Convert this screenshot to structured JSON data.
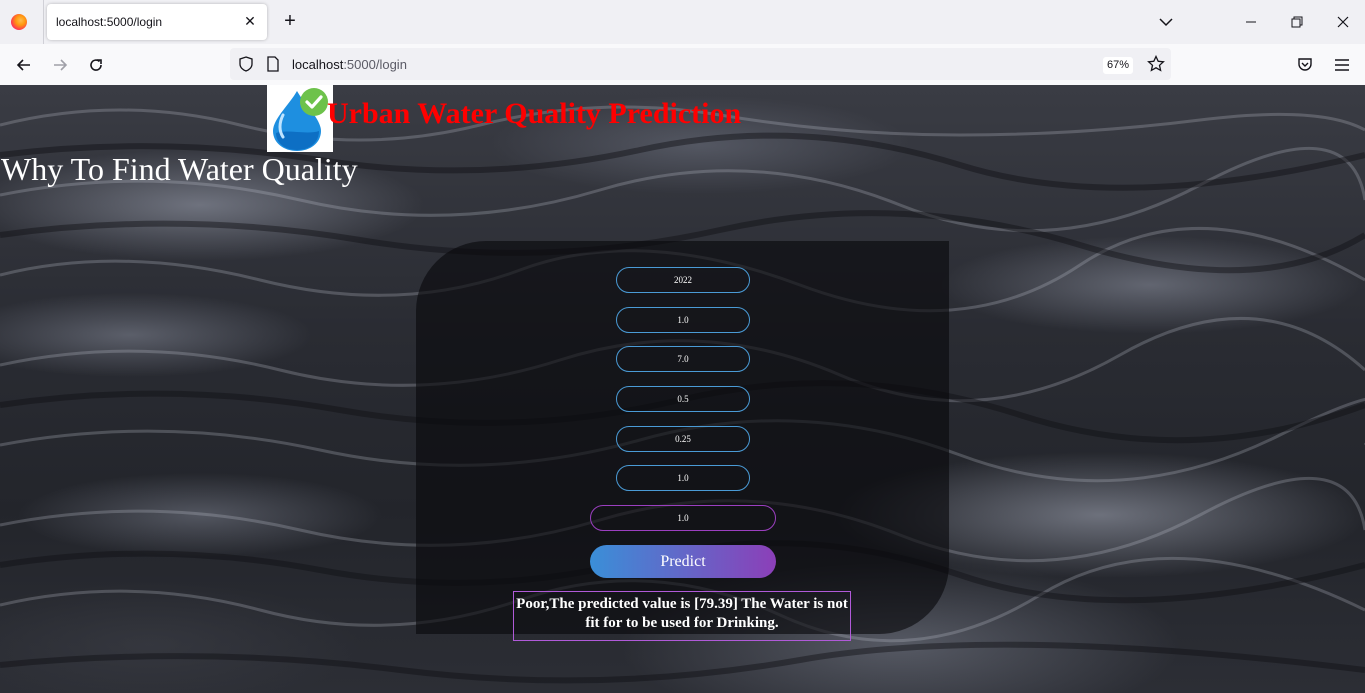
{
  "browser": {
    "tab_title": "localhost:5000/login",
    "url_host": "localhost",
    "url_path": ":5000/login",
    "zoom": "67%"
  },
  "page": {
    "title": "Urban Water Quality Prediction",
    "subheading": "Why To Find Water Quality"
  },
  "form": {
    "fields": [
      "2022",
      "1.0",
      "7.0",
      "0.5",
      "0.25",
      "1.0",
      "1.0"
    ],
    "submit_label": "Predict"
  },
  "result": {
    "text": "Poor,The predicted value is [79.39] The Water is not fit for to be used for Drinking."
  },
  "colors": {
    "title": "#ff0000",
    "field_border": "#4a9bd6",
    "accent_purple": "#9b3fc0"
  }
}
